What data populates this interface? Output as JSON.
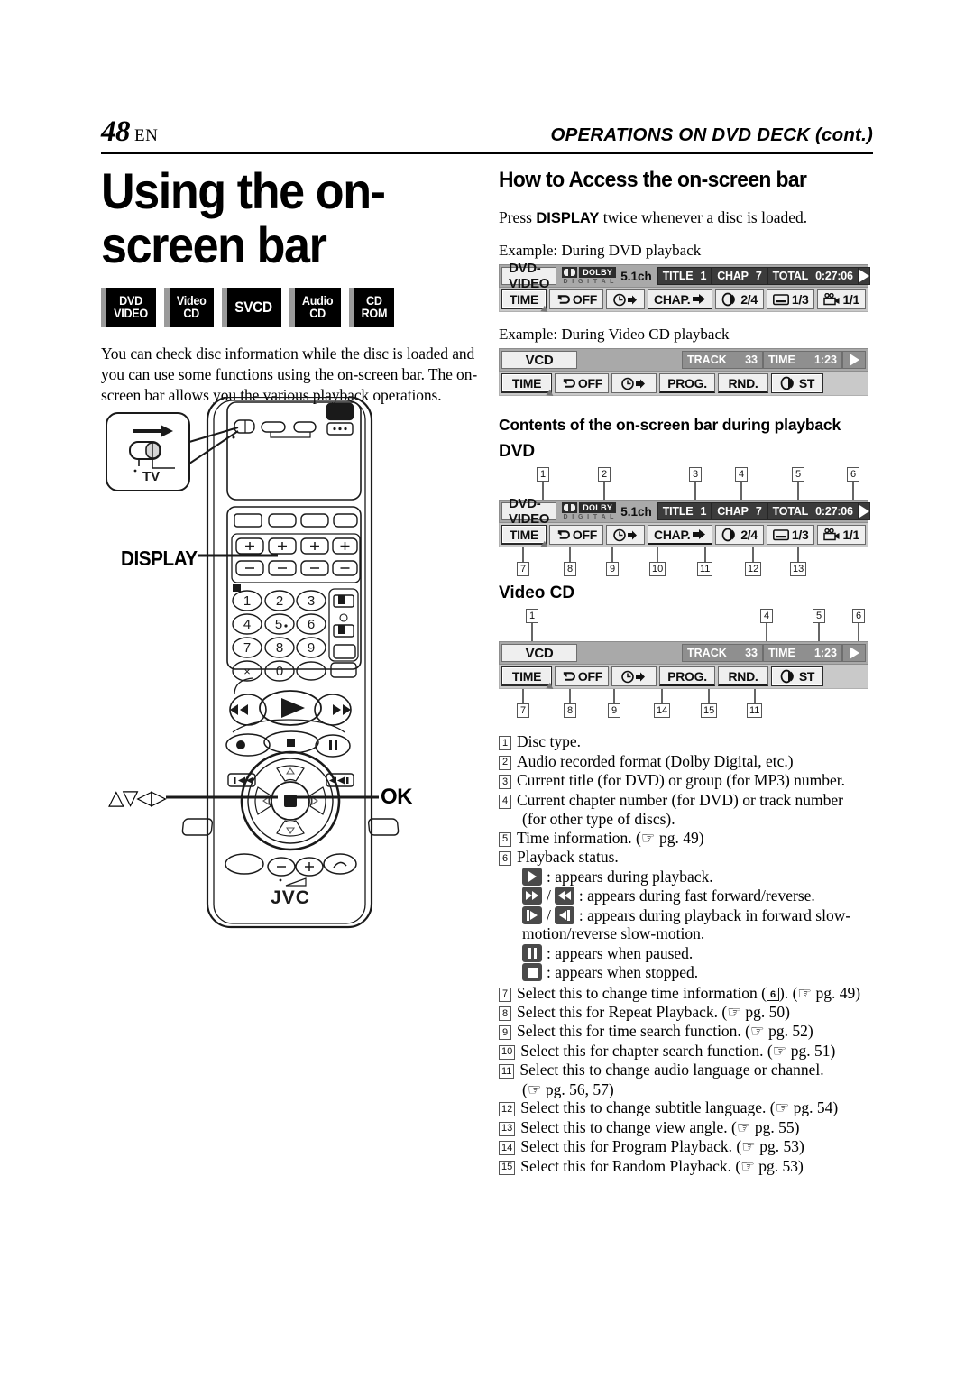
{
  "header": {
    "page_number": "48",
    "page_lang": "EN",
    "running_title": "OPERATIONS ON DVD DECK (cont.)"
  },
  "left": {
    "title_line1": "Using the on-",
    "title_line2": "screen bar",
    "disc_icons": [
      {
        "name": "dvd-video",
        "line1": "DVD",
        "line2": "VIDEO"
      },
      {
        "name": "video-cd",
        "line1": "Video",
        "line2": "CD"
      },
      {
        "name": "svcd",
        "line1": "SVCD",
        "line2": ""
      },
      {
        "name": "audio-cd",
        "line1": "Audio",
        "line2": "CD"
      },
      {
        "name": "cd-rom",
        "line1": "CD",
        "line2": "ROM"
      }
    ],
    "intro": "You can check disc information while the disc is loaded and you can use some functions using the on-screen bar. The on-screen bar allows you the various playback operations."
  },
  "remote": {
    "label_display": "DISPLAY",
    "label_arrows": "△▽◁▷",
    "label_ok": "OK",
    "tv_callout": "TV",
    "brand": "JVC",
    "keys": [
      "1",
      "2",
      "3",
      "4",
      "5",
      "6",
      "7",
      "8",
      "9",
      "0"
    ],
    "key_x": "×",
    "power_glyph": "⏻/I"
  },
  "right": {
    "section_title": "How to Access the on-screen bar",
    "instruction_pre": "Press ",
    "instruction_bold": "DISPLAY",
    "instruction_post": " twice whenever a disc is loaded.",
    "example_dvd": "Example: During DVD playback",
    "example_vcd": "Example: During Video CD playback",
    "contents_heading": "Contents of the on-screen bar during playback",
    "dvd_heading": "DVD",
    "vcd_heading": "Video CD"
  },
  "osd_dvd": {
    "disc_type": "DVD-VIDEO",
    "dolby_word": "DOLBY",
    "dolby_sub": "D I G I T A L",
    "channels": "5.1ch",
    "title_label": "TITLE",
    "title_value": "1",
    "chap_label": "CHAP",
    "chap_value": "7",
    "total_label": "TOTAL",
    "total_value": "0:27:06",
    "status_icon": "play-icon",
    "buttons": [
      {
        "name": "time-button",
        "label": "TIME",
        "selected": true
      },
      {
        "name": "repeat-button",
        "label": "OFF",
        "icon": "repeat-icon"
      },
      {
        "name": "time-search-button",
        "label": "",
        "icon": "clock-arrow-icon"
      },
      {
        "name": "chapter-search-button",
        "label": "CHAP.",
        "icon": "arrow-right-icon"
      },
      {
        "name": "audio-button",
        "label": "2/4",
        "icon": "audio-icon"
      },
      {
        "name": "subtitle-button",
        "label": "1/3",
        "icon": "subtitle-icon"
      },
      {
        "name": "angle-button",
        "label": "1/1",
        "icon": "camera-angle-icon"
      }
    ]
  },
  "osd_vcd": {
    "disc_type": "VCD",
    "track_label": "TRACK",
    "track_value": "33",
    "time_label": "TIME",
    "time_value": "1:23",
    "status_icon": "play-icon",
    "buttons": [
      {
        "name": "time-button",
        "label": "TIME",
        "selected": true
      },
      {
        "name": "repeat-button",
        "label": "OFF",
        "icon": "repeat-icon"
      },
      {
        "name": "time-search-button",
        "label": "",
        "icon": "clock-arrow-icon"
      },
      {
        "name": "program-button",
        "label": "PROG."
      },
      {
        "name": "random-button",
        "label": "RND."
      },
      {
        "name": "audio-button",
        "label": "ST",
        "icon": "audio-icon"
      }
    ]
  },
  "callouts": {
    "dvd_top": [
      "1",
      "2",
      "3",
      "4",
      "5",
      "6"
    ],
    "dvd_bottom": [
      "7",
      "8",
      "9",
      "10",
      "11",
      "12",
      "13"
    ],
    "vcd_top": [
      "1",
      "4",
      "5",
      "6"
    ],
    "vcd_bottom": [
      "7",
      "8",
      "9",
      "14",
      "15",
      "11"
    ]
  },
  "legend": [
    {
      "num": "1",
      "text": "Disc type."
    },
    {
      "num": "2",
      "text": "Audio recorded format (Dolby Digital, etc.)"
    },
    {
      "num": "3",
      "text": "Current title (for DVD) or group (for MP3) number."
    },
    {
      "num": "4",
      "text": "Current chapter number (for DVD) or track number",
      "cont": "(for other type of discs)."
    },
    {
      "num": "5",
      "text": "Time information. (☞ pg. 49)"
    },
    {
      "num": "6",
      "text": "Playback status."
    }
  ],
  "status_lines": [
    {
      "icons": [
        "play"
      ],
      "text": ": appears during playback."
    },
    {
      "icons": [
        "ff",
        "rew"
      ],
      "text": ": appears during fast forward/reverse."
    },
    {
      "icons": [
        "slowfwd",
        "slowrev"
      ],
      "text": ": appears during playback in forward slow-",
      "cont": "motion/reverse slow-motion."
    },
    {
      "icons": [
        "pause"
      ],
      "text": ": appears when paused."
    },
    {
      "icons": [
        "stop"
      ],
      "text": ": appears when stopped."
    }
  ],
  "legend2": [
    {
      "num": "7",
      "pre": "Select this to change time information (",
      "inline": "6",
      "post": "). (☞ pg. 49)"
    },
    {
      "num": "8",
      "text": "Select this for Repeat Playback. (☞ pg. 50)"
    },
    {
      "num": "9",
      "text": "Select this for time search function. (☞ pg. 52)"
    },
    {
      "num": "10",
      "text": "Select this for chapter search function. (☞ pg. 51)"
    },
    {
      "num": "11",
      "text": "Select this to change audio language or channel.",
      "cont": "(☞ pg. 56, 57)"
    },
    {
      "num": "12",
      "text": "Select this to change subtitle language. (☞ pg. 54)"
    },
    {
      "num": "13",
      "text": "Select this to change view angle. (☞ pg. 55)"
    },
    {
      "num": "14",
      "text": "Select this for Program Playback. (☞ pg. 53)"
    },
    {
      "num": "15",
      "text": "Select this for Random Playback. (☞ pg. 53)"
    }
  ]
}
